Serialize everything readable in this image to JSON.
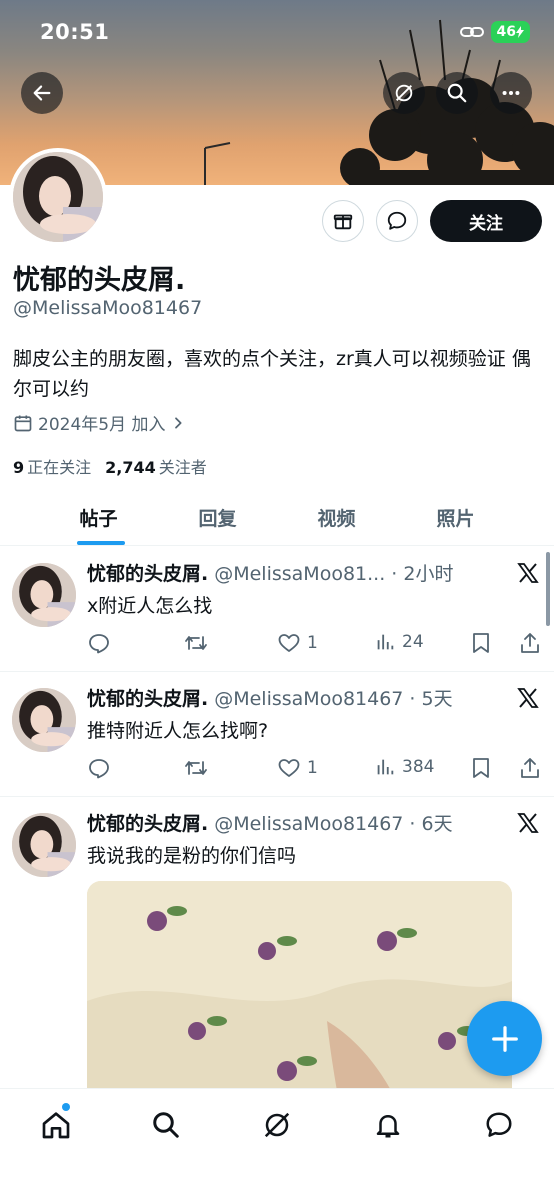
{
  "status_bar": {
    "time": "20:51",
    "battery": "46"
  },
  "profile": {
    "display_name": "忧郁的头皮屑.",
    "handle": "@MelissaMoo81467",
    "bio": "脚皮公主的朋友圈，喜欢的点个关注，zr真人可以视频验证 偶尔可以约",
    "joined": "2024年5月 加入",
    "following_count": "9",
    "following_label": "正在关注",
    "followers_count": "2,744",
    "followers_label": "关注者",
    "follow_button": "关注"
  },
  "tabs": [
    {
      "label": "帖子",
      "active": true
    },
    {
      "label": "回复",
      "active": false
    },
    {
      "label": "视频",
      "active": false
    },
    {
      "label": "照片",
      "active": false
    }
  ],
  "posts": [
    {
      "name": "忧郁的头皮屑.",
      "meta": "@MelissaMoo81... · 2小时",
      "text": "x附近人怎么找",
      "likes": "1",
      "views": "24"
    },
    {
      "name": "忧郁的头皮屑.",
      "meta": "@MelissaMoo81467 · 5天",
      "text": "推特附近人怎么找啊?",
      "likes": "1",
      "views": "384"
    },
    {
      "name": "忧郁的头皮屑.",
      "meta": "@MelissaMoo81467 · 6天",
      "text": "我说我的是粉的你们信吗"
    }
  ],
  "icons": {
    "back": "arrow-left-icon",
    "grok": "grok-icon",
    "search": "search-icon",
    "more": "more-horizontal-icon",
    "gift": "gift-icon",
    "message": "message-bubble-icon",
    "calendar": "calendar-icon",
    "chevron": "chevron-right-icon",
    "reply": "reply-icon",
    "retweet": "retweet-icon",
    "like": "heart-icon",
    "views": "views-bar-icon",
    "bookmark": "bookmark-icon",
    "share": "share-icon",
    "x_logo": "x-logo-icon",
    "compose": "plus-icon",
    "home": "home-icon",
    "explore": "search-icon",
    "notifications": "bell-icon",
    "dm": "message-bubble-icon"
  },
  "colors": {
    "accent": "#1d9bf0",
    "text_primary": "#0f1419",
    "text_secondary": "#536471",
    "battery": "#2bd158"
  }
}
